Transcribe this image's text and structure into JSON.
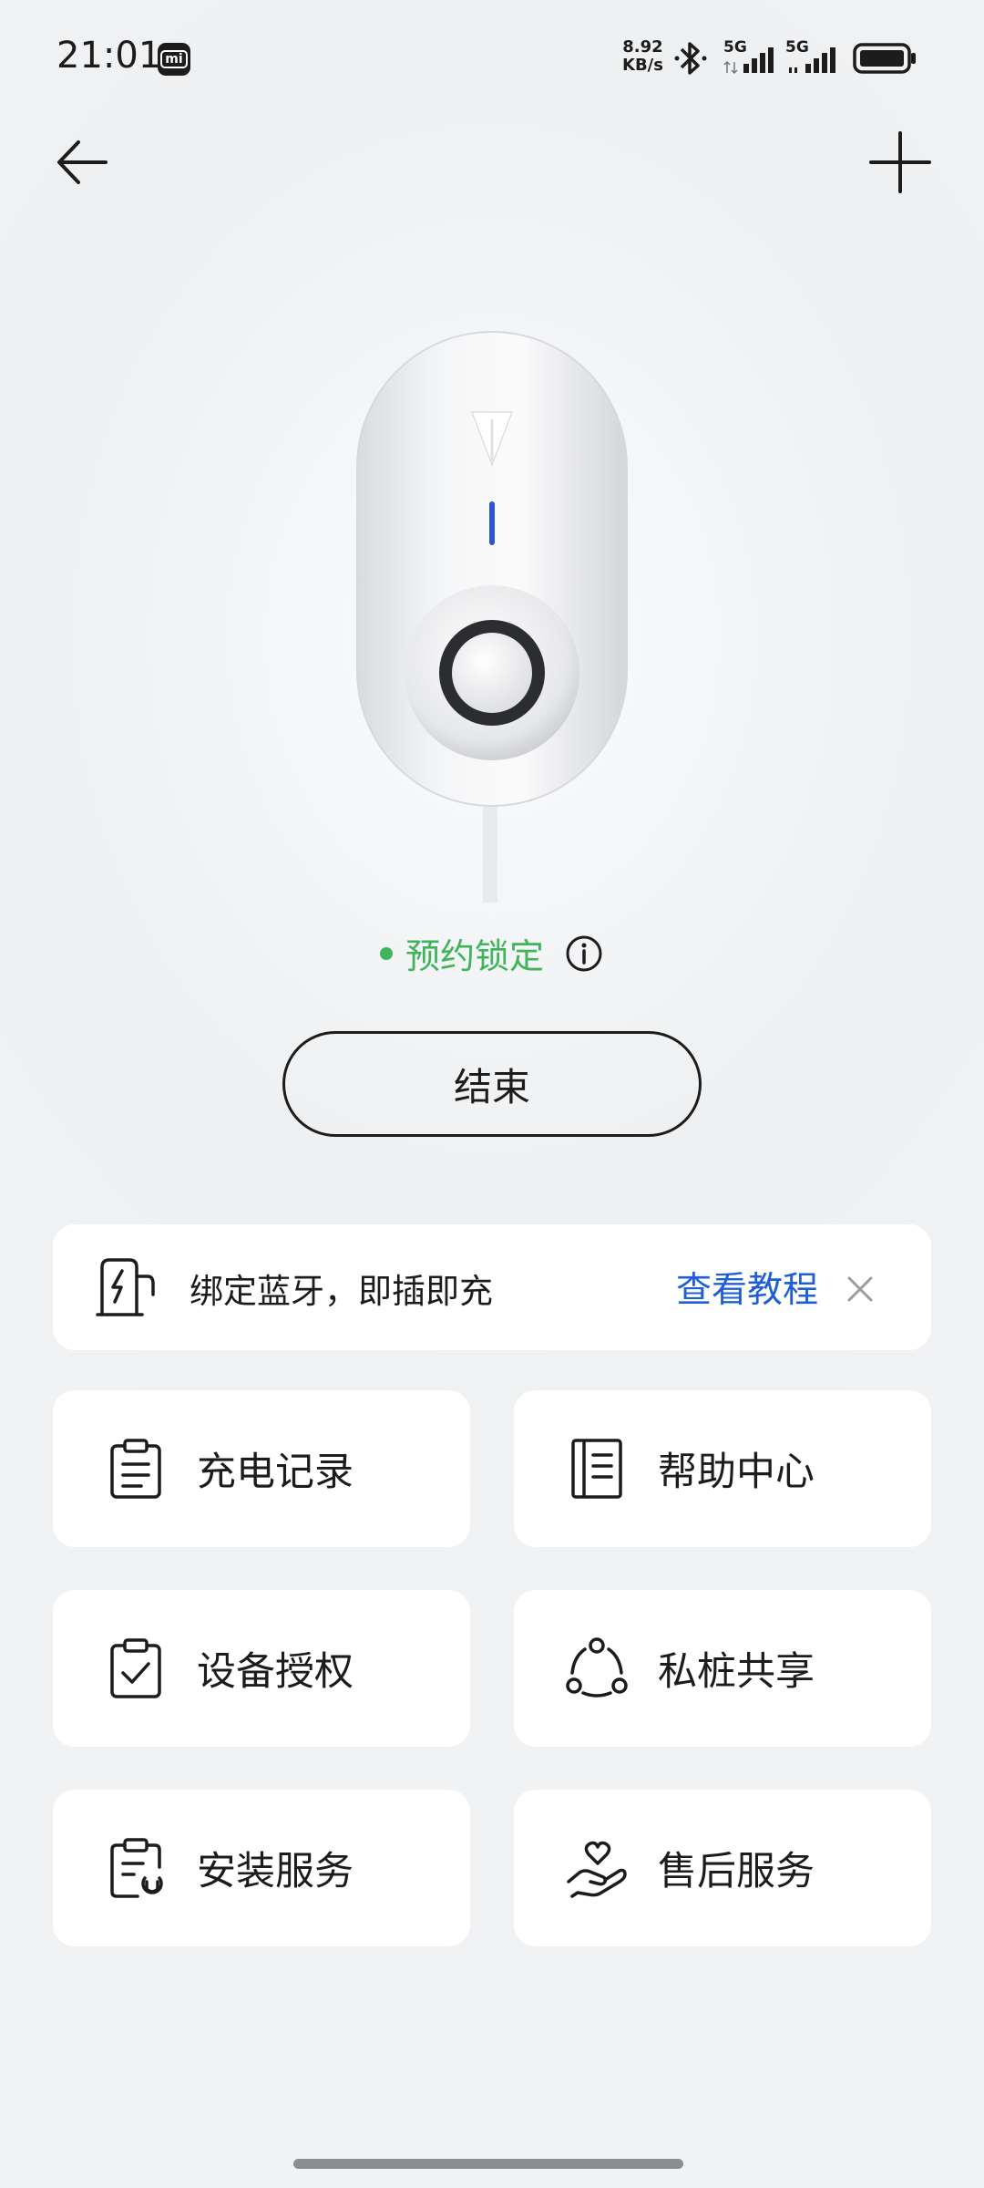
{
  "status_bar": {
    "time": "21:01",
    "mi_badge": "mi",
    "net_speed_value": "8.92",
    "net_speed_unit": "KB/s",
    "sim1_label": "5G",
    "sim2_label": "5G"
  },
  "nav": {
    "back_icon": "arrow-left-icon",
    "add_icon": "plus-icon"
  },
  "device": {
    "icon": "wall-charger-device"
  },
  "status": {
    "text": "预约锁定",
    "color": "#3fb45a"
  },
  "end_button_label": "结束",
  "banner": {
    "text": "绑定蓝牙，即插即充",
    "link": "查看教程",
    "link_color": "#1e5fd6"
  },
  "menu": [
    {
      "label": "充电记录",
      "icon": "clipboard-list-icon"
    },
    {
      "label": "帮助中心",
      "icon": "book-icon"
    },
    {
      "label": "设备授权",
      "icon": "clipboard-check-icon"
    },
    {
      "label": "私桩共享",
      "icon": "share-nodes-icon"
    },
    {
      "label": "安装服务",
      "icon": "clipboard-wrench-icon"
    },
    {
      "label": "售后服务",
      "icon": "hand-heart-icon"
    }
  ]
}
